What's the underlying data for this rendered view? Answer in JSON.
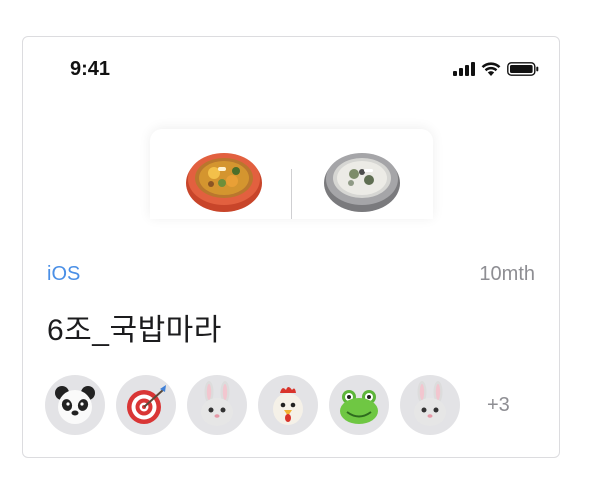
{
  "status": {
    "time": "9:41"
  },
  "project": {
    "category": "iOS",
    "duration": "10mth",
    "title": "6조_국밥마라"
  },
  "members": {
    "avatars": [
      "panda-icon",
      "dart-target-icon",
      "rabbit-icon",
      "rooster-icon",
      "frog-icon",
      "rabbit-icon"
    ],
    "more": "+3"
  },
  "colors": {
    "accent": "#4a8fe6",
    "muted": "#8e8e93"
  }
}
